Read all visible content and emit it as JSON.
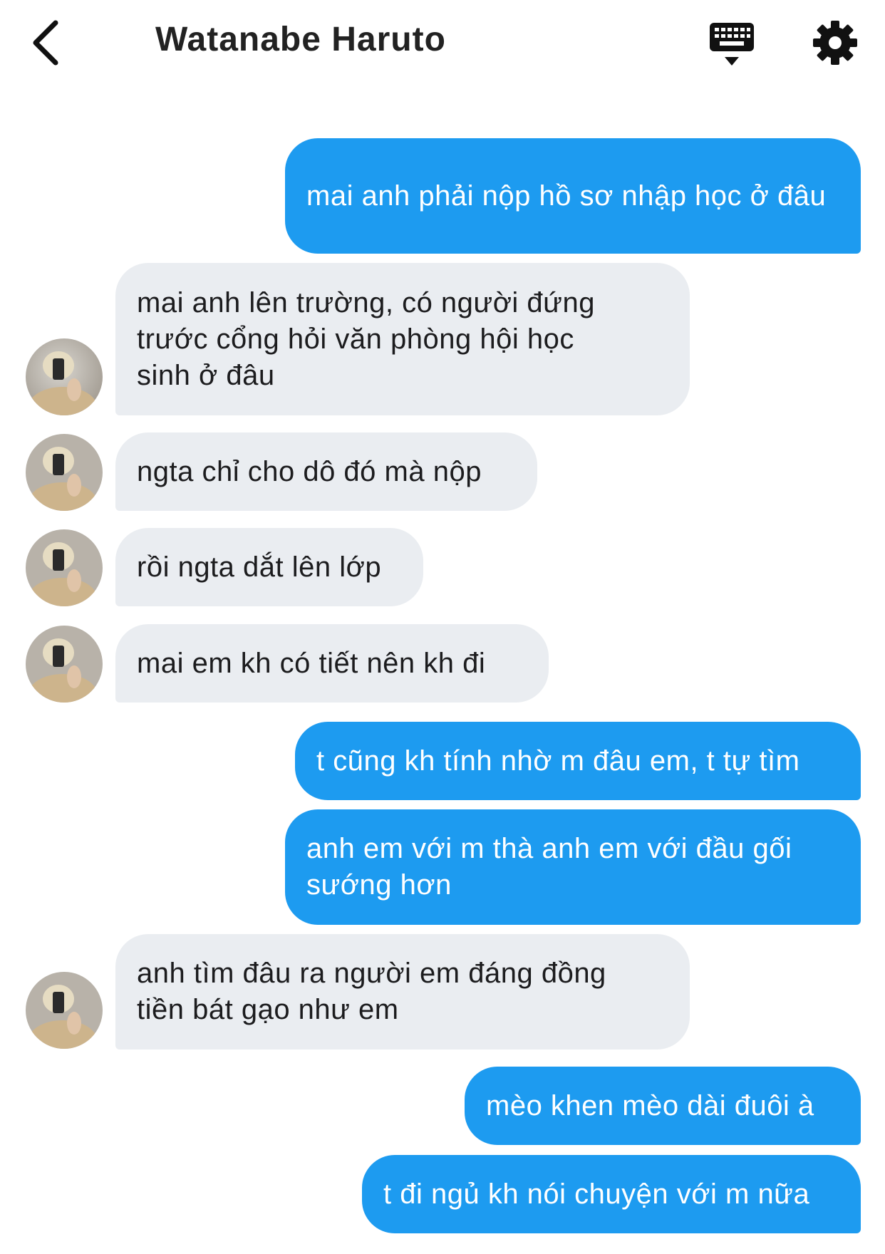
{
  "header": {
    "title": "Watanabe Haruto",
    "icons": {
      "back": "chevron-left-icon",
      "keyboard": "keyboard-icon",
      "settings": "gear-icon"
    }
  },
  "colors": {
    "sent_bubble": "#1d9bf0",
    "received_bubble": "#eaedf1",
    "sent_text": "#ffffff",
    "received_text": "#1c1c1e"
  },
  "messages": [
    {
      "from": "me",
      "text": "mai anh phải nộp hồ sơ nhập học ở đâu"
    },
    {
      "from": "them",
      "text": "mai anh lên trường, có người đứng trước cổng hỏi văn phòng hội học sinh ở đâu"
    },
    {
      "from": "them",
      "text": "ngta chỉ cho dô đó mà nộp"
    },
    {
      "from": "them",
      "text": "rồi ngta dắt lên lớp"
    },
    {
      "from": "them",
      "text": "mai em kh có tiết nên kh đi"
    },
    {
      "from": "me",
      "text": "t cũng kh tính nhờ m đâu em, t tự tìm"
    },
    {
      "from": "me",
      "text": "anh em với m thà anh em với đầu gối sướng hơn"
    },
    {
      "from": "them",
      "text": "anh tìm đâu ra người em đáng đồng tiền bát gạo như em"
    },
    {
      "from": "me",
      "text": "mèo khen mèo dài đuôi à"
    },
    {
      "from": "me",
      "text": "t đi ngủ kh nói chuyện với m nữa"
    }
  ]
}
